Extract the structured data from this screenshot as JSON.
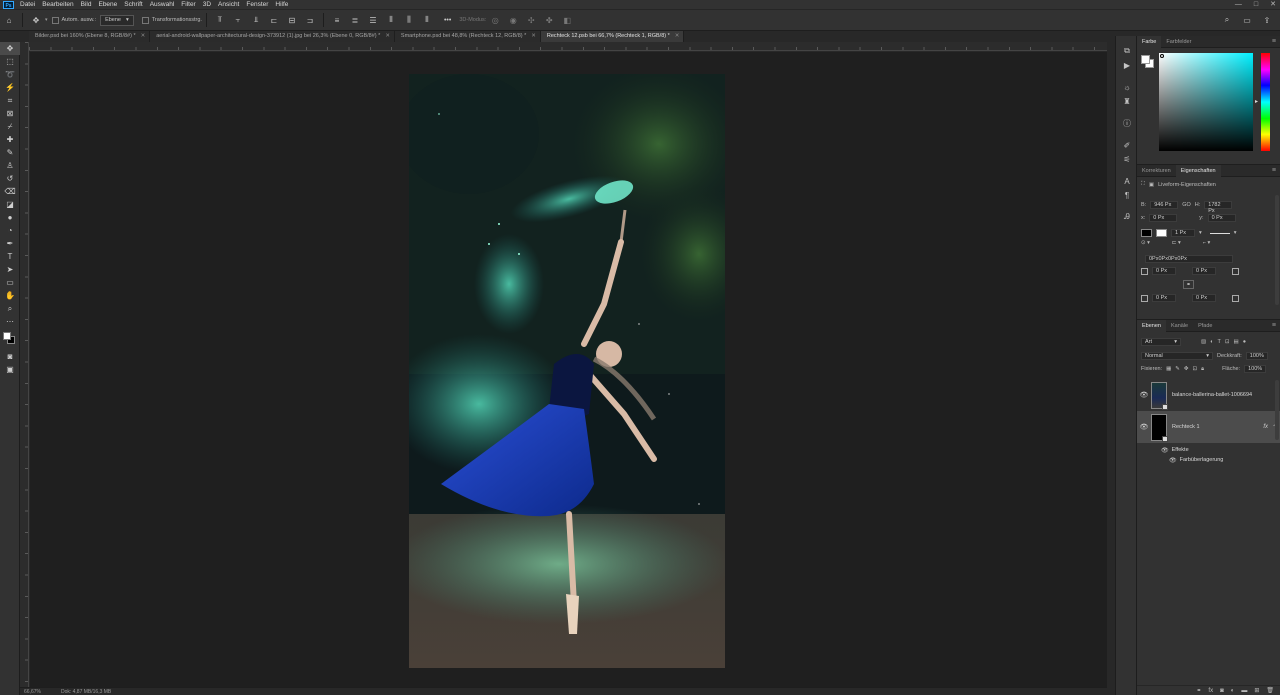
{
  "menubar": {
    "logo": "Ps",
    "items": [
      "Datei",
      "Bearbeiten",
      "Bild",
      "Ebene",
      "Schrift",
      "Auswahl",
      "Filter",
      "3D",
      "Ansicht",
      "Fenster",
      "Hilfe"
    ],
    "window_controls": [
      "—",
      "□",
      "✕"
    ]
  },
  "options_bar": {
    "auto_select_label": "Autom. ausw.:",
    "auto_select_target": "Ebene",
    "transform_controls_label": "Transformationsstrg.",
    "more_label": "•••",
    "mode_3d_label": "3D-Modus:"
  },
  "tabs": [
    {
      "label": "Bilder.psd bei 160% (Ebene 8, RGB/8#) *",
      "active": false
    },
    {
      "label": "aerial-android-wallpaper-architectural-design-373912 (1).jpg bei 26,3% (Ebene 0, RGB/8#) *",
      "active": false
    },
    {
      "label": "Smartphone.psd bei 48,8% (Rechteck 12, RGB/8) *",
      "active": false
    },
    {
      "label": "Rechteck 12.psb bei 66,7% (Rechteck 1, RGB/8) *",
      "active": true
    }
  ],
  "status": {
    "zoom": "66,67%",
    "doc": "Dok: 4,87 MB/16,3 MB"
  },
  "panels": {
    "color": {
      "tabs": [
        "Farbe",
        "Farbfelder"
      ],
      "colors": {
        "foreground": "#ffffff",
        "background": "#ffffff",
        "picker_hue": "#00f0ff"
      }
    },
    "properties": {
      "tabs": [
        "Korrekturen",
        "Eigenschaften"
      ],
      "heading": "Liveform-Eigenschaften",
      "w_label": "B:",
      "w_value": "946 Px",
      "link_label": "GO",
      "h_label": "H:",
      "h_value": "1782 Px",
      "x_label": "x:",
      "x_value": "0 Px",
      "y_label": "y:",
      "y_value": "0 Px",
      "stroke_width": "1 Px",
      "corner_radius_summary": "0Px0Px0Px0Px",
      "radius_tl": "0 Px",
      "radius_tr": "0 Px",
      "radius_bl": "0 Px",
      "radius_br": "0 Px"
    },
    "layers": {
      "tabs": [
        "Ebenen",
        "Kanäle",
        "Pfade"
      ],
      "filter_kind": "Art",
      "blend_mode": "Normal",
      "opacity_label": "Deckkraft:",
      "opacity_value": "100%",
      "lock_label": "Fixieren:",
      "fill_label": "Fläche:",
      "fill_value": "100%",
      "items": [
        {
          "name": "balance-ballerina-ballet-1006694"
        },
        {
          "name": "Rechteck 1",
          "fx": "fx"
        }
      ],
      "effects_label": "Effekte",
      "effect_name": "Farbüberlagerung",
      "bottom_icons": [
        "link-icon",
        "fx-icon",
        "mask-icon",
        "adjustment-icon",
        "group-icon",
        "new-layer-icon",
        "trash-icon"
      ]
    }
  }
}
